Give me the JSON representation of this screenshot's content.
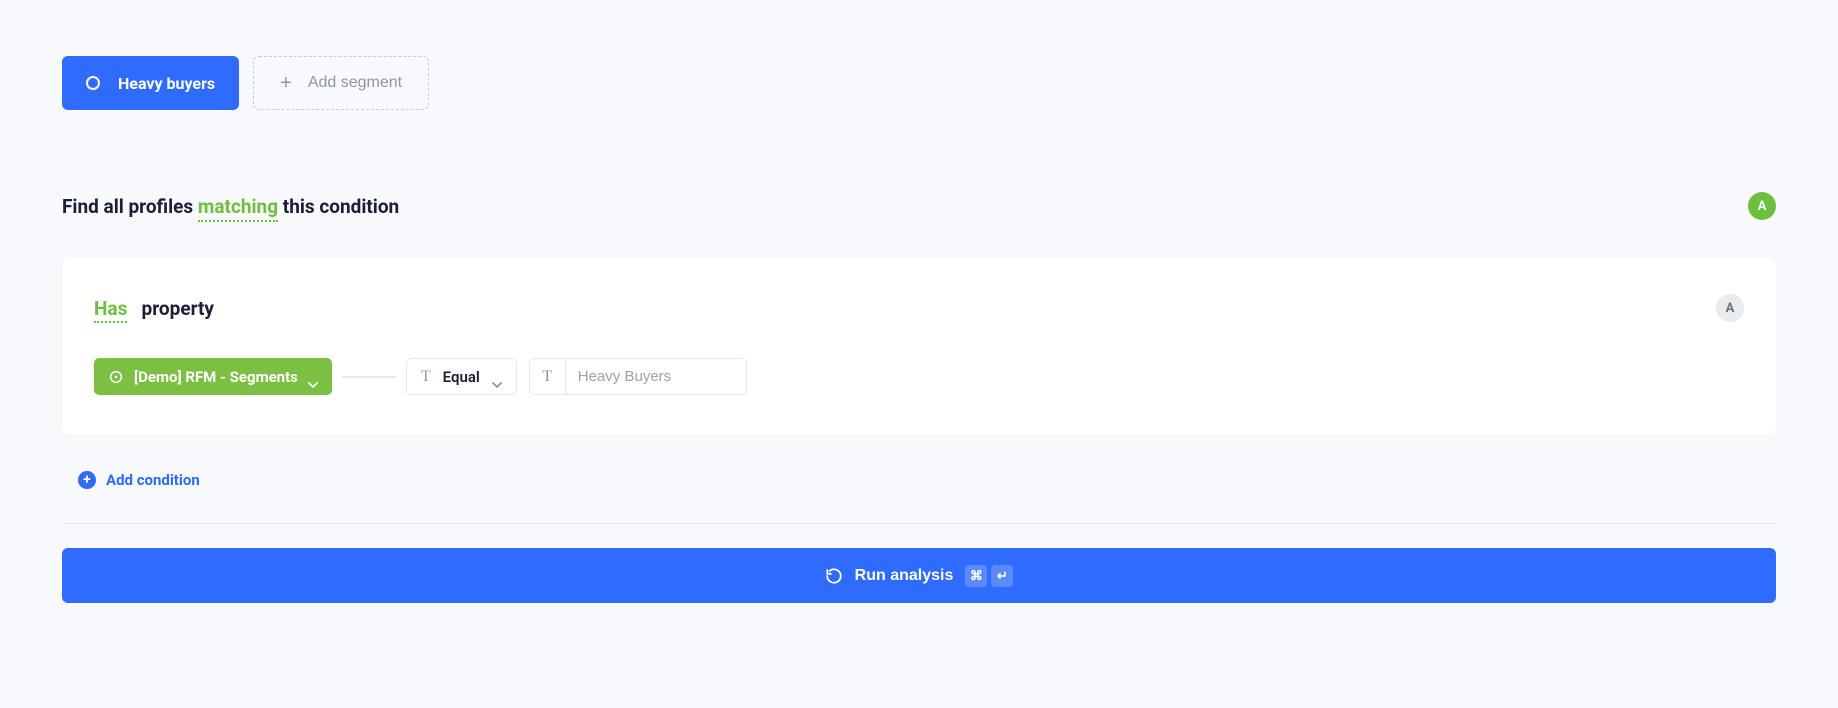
{
  "segments": {
    "active_label": "Heavy buyers",
    "add_label": "Add segment"
  },
  "heading": {
    "prefix": "Find all profiles ",
    "matching": "matching",
    "suffix": " this condition"
  },
  "avatar": {
    "letter": "A"
  },
  "condition": {
    "has_label": "Has",
    "property_label": "property",
    "avatar_letter": "A",
    "property_value": "[Demo] RFM - Segments",
    "operator": "Equal",
    "value_placeholder": "Heavy Buyers"
  },
  "actions": {
    "add_condition": "Add condition",
    "run_analysis": "Run analysis",
    "shortcut_cmd": "⌘",
    "shortcut_enter": "↵"
  }
}
